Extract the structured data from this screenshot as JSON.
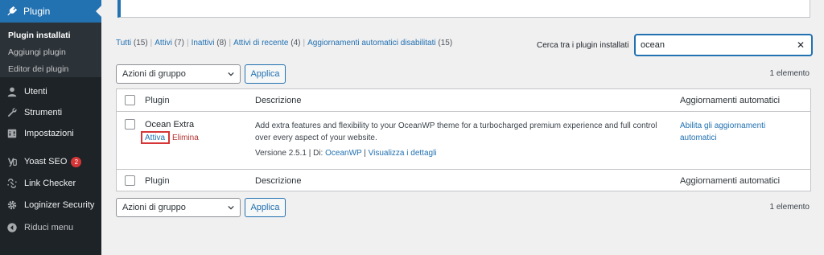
{
  "sidebar": {
    "plugin_label": "Plugin",
    "submenu": [
      "Plugin installati",
      "Aggiungi plugin",
      "Editor dei plugin"
    ],
    "items": [
      {
        "label": "Utenti",
        "icon": "user-icon"
      },
      {
        "label": "Strumenti",
        "icon": "wrench-icon"
      },
      {
        "label": "Impostazioni",
        "icon": "settings-icon"
      },
      {
        "label": "Yoast SEO",
        "icon": "yoast-icon",
        "badge": "2"
      },
      {
        "label": "Link Checker",
        "icon": "link-checker-icon"
      },
      {
        "label": "Loginizer Security",
        "icon": "gear-icon"
      },
      {
        "label": "Riduci menu",
        "icon": "collapse-icon"
      }
    ]
  },
  "filters": {
    "all": "Tutti",
    "all_count": "(15)",
    "active": "Attivi",
    "active_count": "(7)",
    "inactive": "Inattivi",
    "inactive_count": "(8)",
    "recent": "Attivi di recente",
    "recent_count": "(4)",
    "auto_disabled": "Aggiornamenti automatici disabilitati",
    "auto_disabled_count": "(15)"
  },
  "search": {
    "label": "Cerca tra i plugin installati",
    "value": "ocean",
    "clear": "✕"
  },
  "bulk": {
    "label": "Azioni di gruppo",
    "apply": "Applica",
    "count": "1 elemento"
  },
  "table": {
    "headers": {
      "plugin": "Plugin",
      "description": "Descrizione",
      "auto": "Aggiornamenti automatici"
    },
    "row": {
      "name": "Ocean Extra",
      "activate": "Attiva",
      "delete": "Elimina",
      "description": "Add extra features and flexibility to your OceanWP theme for a turbocharged premium experience and full control over every aspect of your website.",
      "version": "Versione 2.5.1",
      "by": "Di:",
      "author": "OceanWP",
      "details": "Visualizza i dettagli",
      "auto_link": "Abilita gli aggiornamenti automatici"
    }
  },
  "colors": {
    "sidebar_bg": "#1d2327",
    "accent": "#2271b1",
    "highlight_box": "#d63638",
    "delete": "#b32d2e"
  }
}
